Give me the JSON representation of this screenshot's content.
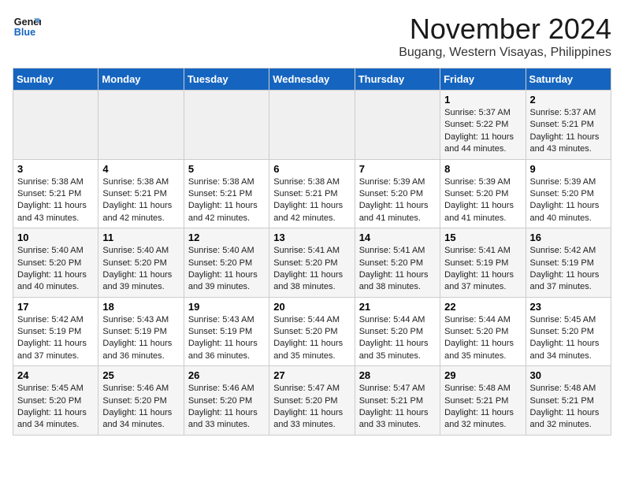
{
  "header": {
    "logo_general": "General",
    "logo_blue": "Blue",
    "month_title": "November 2024",
    "location": "Bugang, Western Visayas, Philippines"
  },
  "weekdays": [
    "Sunday",
    "Monday",
    "Tuesday",
    "Wednesday",
    "Thursday",
    "Friday",
    "Saturday"
  ],
  "weeks": [
    [
      {
        "day": "",
        "info": "",
        "empty": true
      },
      {
        "day": "",
        "info": "",
        "empty": true
      },
      {
        "day": "",
        "info": "",
        "empty": true
      },
      {
        "day": "",
        "info": "",
        "empty": true
      },
      {
        "day": "",
        "info": "",
        "empty": true
      },
      {
        "day": "1",
        "info": "Sunrise: 5:37 AM\nSunset: 5:22 PM\nDaylight: 11 hours\nand 44 minutes.",
        "empty": false
      },
      {
        "day": "2",
        "info": "Sunrise: 5:37 AM\nSunset: 5:21 PM\nDaylight: 11 hours\nand 43 minutes.",
        "empty": false
      }
    ],
    [
      {
        "day": "3",
        "info": "Sunrise: 5:38 AM\nSunset: 5:21 PM\nDaylight: 11 hours\nand 43 minutes.",
        "empty": false
      },
      {
        "day": "4",
        "info": "Sunrise: 5:38 AM\nSunset: 5:21 PM\nDaylight: 11 hours\nand 42 minutes.",
        "empty": false
      },
      {
        "day": "5",
        "info": "Sunrise: 5:38 AM\nSunset: 5:21 PM\nDaylight: 11 hours\nand 42 minutes.",
        "empty": false
      },
      {
        "day": "6",
        "info": "Sunrise: 5:38 AM\nSunset: 5:21 PM\nDaylight: 11 hours\nand 42 minutes.",
        "empty": false
      },
      {
        "day": "7",
        "info": "Sunrise: 5:39 AM\nSunset: 5:20 PM\nDaylight: 11 hours\nand 41 minutes.",
        "empty": false
      },
      {
        "day": "8",
        "info": "Sunrise: 5:39 AM\nSunset: 5:20 PM\nDaylight: 11 hours\nand 41 minutes.",
        "empty": false
      },
      {
        "day": "9",
        "info": "Sunrise: 5:39 AM\nSunset: 5:20 PM\nDaylight: 11 hours\nand 40 minutes.",
        "empty": false
      }
    ],
    [
      {
        "day": "10",
        "info": "Sunrise: 5:40 AM\nSunset: 5:20 PM\nDaylight: 11 hours\nand 40 minutes.",
        "empty": false
      },
      {
        "day": "11",
        "info": "Sunrise: 5:40 AM\nSunset: 5:20 PM\nDaylight: 11 hours\nand 39 minutes.",
        "empty": false
      },
      {
        "day": "12",
        "info": "Sunrise: 5:40 AM\nSunset: 5:20 PM\nDaylight: 11 hours\nand 39 minutes.",
        "empty": false
      },
      {
        "day": "13",
        "info": "Sunrise: 5:41 AM\nSunset: 5:20 PM\nDaylight: 11 hours\nand 38 minutes.",
        "empty": false
      },
      {
        "day": "14",
        "info": "Sunrise: 5:41 AM\nSunset: 5:20 PM\nDaylight: 11 hours\nand 38 minutes.",
        "empty": false
      },
      {
        "day": "15",
        "info": "Sunrise: 5:41 AM\nSunset: 5:19 PM\nDaylight: 11 hours\nand 37 minutes.",
        "empty": false
      },
      {
        "day": "16",
        "info": "Sunrise: 5:42 AM\nSunset: 5:19 PM\nDaylight: 11 hours\nand 37 minutes.",
        "empty": false
      }
    ],
    [
      {
        "day": "17",
        "info": "Sunrise: 5:42 AM\nSunset: 5:19 PM\nDaylight: 11 hours\nand 37 minutes.",
        "empty": false
      },
      {
        "day": "18",
        "info": "Sunrise: 5:43 AM\nSunset: 5:19 PM\nDaylight: 11 hours\nand 36 minutes.",
        "empty": false
      },
      {
        "day": "19",
        "info": "Sunrise: 5:43 AM\nSunset: 5:19 PM\nDaylight: 11 hours\nand 36 minutes.",
        "empty": false
      },
      {
        "day": "20",
        "info": "Sunrise: 5:44 AM\nSunset: 5:20 PM\nDaylight: 11 hours\nand 35 minutes.",
        "empty": false
      },
      {
        "day": "21",
        "info": "Sunrise: 5:44 AM\nSunset: 5:20 PM\nDaylight: 11 hours\nand 35 minutes.",
        "empty": false
      },
      {
        "day": "22",
        "info": "Sunrise: 5:44 AM\nSunset: 5:20 PM\nDaylight: 11 hours\nand 35 minutes.",
        "empty": false
      },
      {
        "day": "23",
        "info": "Sunrise: 5:45 AM\nSunset: 5:20 PM\nDaylight: 11 hours\nand 34 minutes.",
        "empty": false
      }
    ],
    [
      {
        "day": "24",
        "info": "Sunrise: 5:45 AM\nSunset: 5:20 PM\nDaylight: 11 hours\nand 34 minutes.",
        "empty": false
      },
      {
        "day": "25",
        "info": "Sunrise: 5:46 AM\nSunset: 5:20 PM\nDaylight: 11 hours\nand 34 minutes.",
        "empty": false
      },
      {
        "day": "26",
        "info": "Sunrise: 5:46 AM\nSunset: 5:20 PM\nDaylight: 11 hours\nand 33 minutes.",
        "empty": false
      },
      {
        "day": "27",
        "info": "Sunrise: 5:47 AM\nSunset: 5:20 PM\nDaylight: 11 hours\nand 33 minutes.",
        "empty": false
      },
      {
        "day": "28",
        "info": "Sunrise: 5:47 AM\nSunset: 5:21 PM\nDaylight: 11 hours\nand 33 minutes.",
        "empty": false
      },
      {
        "day": "29",
        "info": "Sunrise: 5:48 AM\nSunset: 5:21 PM\nDaylight: 11 hours\nand 32 minutes.",
        "empty": false
      },
      {
        "day": "30",
        "info": "Sunrise: 5:48 AM\nSunset: 5:21 PM\nDaylight: 11 hours\nand 32 minutes.",
        "empty": false
      }
    ]
  ]
}
